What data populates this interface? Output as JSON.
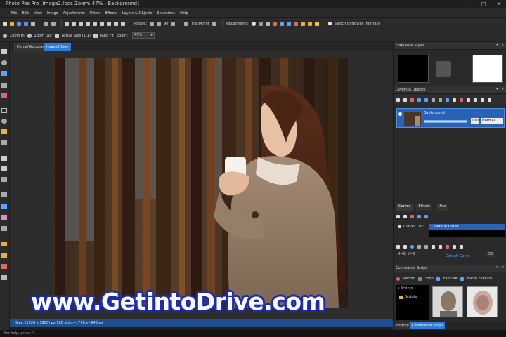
{
  "window": {
    "title": "Photo Pos Pro [Image2.fpos Zoom: 47% - Background]",
    "controls": [
      "–",
      "□",
      "✕"
    ]
  },
  "menu": [
    "File",
    "Edit",
    "View",
    "Image",
    "Adjustments",
    "Filters",
    "Effects",
    "Layers & Objects",
    "Selections",
    "Help"
  ],
  "toolbar": {
    "rotate_label": "Rotate:",
    "rotate_value": "90",
    "flip_label": "Flip/Mirror",
    "adjustments_label": "Adjustments:",
    "novice_label": "Switch to Novice Interface"
  },
  "toolbar2": {
    "zoom_in": "Zoom In",
    "zoom_out": "Zoom Out",
    "actual_size": "Actual Size (1:1)",
    "auto_fit": "Auto Fit",
    "zoom_label": "Zoom:",
    "zoom_value": "47%"
  },
  "doc_tabs": [
    "Home/Welcome",
    "Image2.fpos"
  ],
  "status": {
    "info": "Size: (1920 x 1280) px,100 dpi  x=1776,y=546 px"
  },
  "bottom_hint": "For help, press F1",
  "watermark": "www.GetintoDrive.com",
  "right_panel": {
    "fore_back_title": "Fore/Back Styles",
    "layers_title": "Layers & Objects",
    "layer": {
      "name": "Background",
      "opacity": "100",
      "blend": "Normal",
      "opacity_fraction": 1.0
    },
    "sub_tabs": [
      "Curves",
      "Effects",
      "Misc"
    ],
    "curves": {
      "label": "Curves List:",
      "selected": "Default Curve",
      "coords": "X=0, Y=0",
      "link": "Default Curve",
      "value": "50"
    },
    "commands_title": "Commands Script",
    "script_controls": [
      "Record",
      "Stop",
      "Execute",
      "Batch Execute"
    ],
    "scripts_folder": "Scripts",
    "scripts_label": "s Scripts",
    "bottom_tabs": [
      "History",
      "Commands Script"
    ]
  },
  "colors": {
    "accent": "#2e7cd6",
    "status_bar": "#1f4f8c",
    "background": "#1e1e1e",
    "panel": "#2a2a2a"
  }
}
